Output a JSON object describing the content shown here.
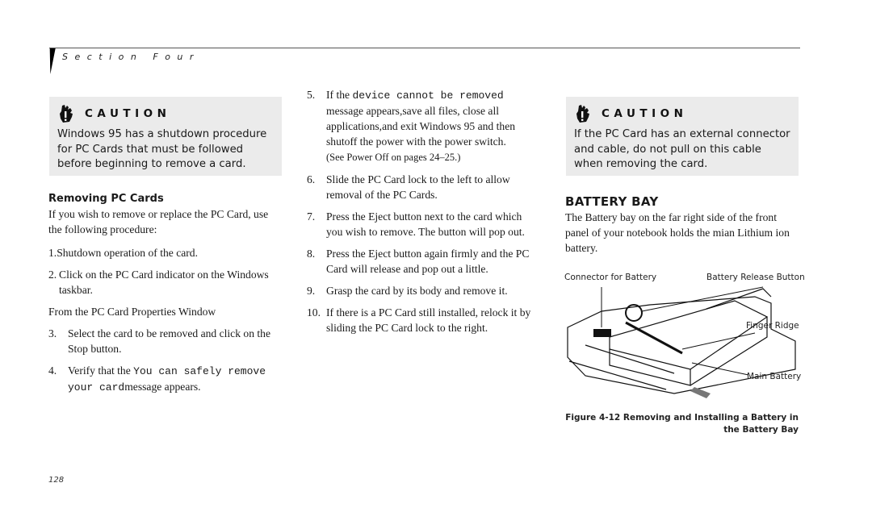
{
  "header": {
    "section_label": "Section Four"
  },
  "left_column": {
    "caution": {
      "title": "CAUTION",
      "icon": "hand-caution-icon",
      "text": "Windows 95 has a shutdown procedure for PC Cards that must be followed before beginning to remove a card."
    },
    "subheading": "Removing PC Cards",
    "intro": "If you wish to remove or replace the PC Card, use the following procedure:",
    "step1": "1.Shutdown operation of the card.",
    "step2": {
      "num": "2.",
      "text": "Click on the PC Card indicator on the Windows taskbar."
    },
    "properties_heading": "From the PC Card Properties Window",
    "step3": {
      "num": "3.",
      "text": "Select the card to be removed and click on the Stop button."
    },
    "step4": {
      "num": "4.",
      "text_before": "Verify that the ",
      "mono": "You can safely remove your card",
      "text_after": "message appears."
    }
  },
  "middle_column": {
    "step5": {
      "num": "5.",
      "text_before": "If the ",
      "mono": "device cannot be removed",
      "text_after": " message appears,save all files, close all applications,and exit Windows 95 and then shutoff the power with the power switch.",
      "note": "(See Power Off on pages 24–25.)"
    },
    "step6": {
      "num": "6.",
      "text": "Slide the PC Card lock to the left to allow removal of the PC Cards."
    },
    "step7": {
      "num": "7.",
      "text": "Press the Eject button next to the card which you wish to remove. The button will pop out."
    },
    "step8": {
      "num": "8.",
      "text": "Press the Eject button again firmly and the PC Card will release and pop out a little."
    },
    "step9": {
      "num": "9.",
      "text": "Grasp the card by its body and remove it."
    },
    "step10": {
      "num": "10.",
      "text": "If there is a PC Card still installed, relock it by sliding the PC Card lock to the right."
    }
  },
  "right_column": {
    "caution": {
      "title": "CAUTION",
      "icon": "hand-caution-icon",
      "text": "If the PC Card has an external connector and cable, do not pull on this cable when removing the card."
    },
    "battery_title": "BATTERY BAY",
    "battery_text": "The Battery bay on the far right side of the front panel of your notebook holds the mian Lithium ion battery.",
    "figure": {
      "callouts": {
        "connector": "Connector for Battery",
        "release_button": "Battery Release Button",
        "finger_ridge": "Finger Ridge",
        "main_battery": "Main Battery"
      },
      "caption_line1": "Figure 4-12 Removing and Installing a Battery in",
      "caption_line2": "the Battery Bay"
    }
  },
  "footer": {
    "page_number": "128"
  }
}
